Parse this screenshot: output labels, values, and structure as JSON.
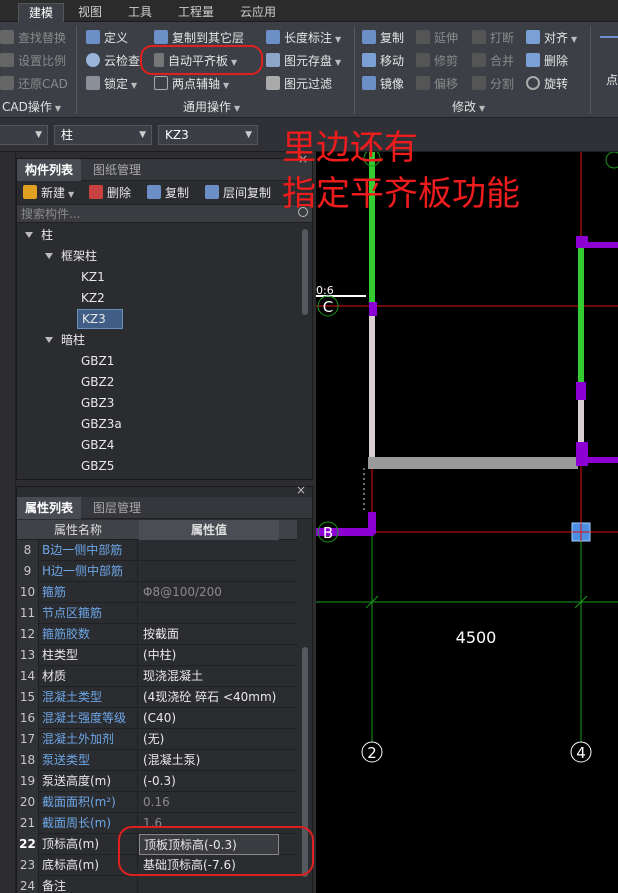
{
  "menu": {
    "tabs": [
      {
        "label": "建模",
        "active": true
      },
      {
        "label": "视图",
        "active": false
      },
      {
        "label": "工具",
        "active": false
      },
      {
        "label": "工程量",
        "active": false
      },
      {
        "label": "云应用",
        "active": false
      }
    ]
  },
  "ribbon": {
    "cad": {
      "find_replace": "查找替换",
      "set_ratio": "设置比例",
      "restore_cad": "还原CAD",
      "group_label": "CAD操作"
    },
    "general": {
      "define": "定义",
      "copy_to_floor": "复制到其它层",
      "length_label": "长度标注",
      "cloud_check": "云检查",
      "auto_align_slab": "自动平齐板",
      "save_element": "图元存盘",
      "lock": "锁定",
      "two_point_axis": "两点辅轴",
      "element_filter": "图元过滤",
      "group_label": "通用操作"
    },
    "modify": {
      "copy": "复制",
      "extend": "延伸",
      "break": "打断",
      "align": "对齐",
      "move": "移动",
      "trim": "修剪",
      "merge": "合并",
      "delete": "删除",
      "mirror": "镜像",
      "offset": "偏移",
      "split": "分割",
      "rotate": "旋转",
      "group_label": "修改"
    },
    "draw_partial": "点"
  },
  "selectors": {
    "category": "柱",
    "component": "KZ3"
  },
  "component_panel": {
    "tab_active": "构件列表",
    "tab_other": "图纸管理",
    "new_btn": "新建",
    "delete_btn": "删除",
    "copy_btn": "复制",
    "floor_copy_btn": "层间复制",
    "search_placeholder": "搜索构件...",
    "tree": {
      "root": "柱",
      "group1": "框架柱",
      "group1_items": [
        "KZ1",
        "KZ2",
        "KZ3"
      ],
      "group2": "暗柱",
      "group2_items": [
        "GBZ1",
        "GBZ2",
        "GBZ3",
        "GBZ3a",
        "GBZ4",
        "GBZ5"
      ]
    }
  },
  "property_panel": {
    "tab_active": "属性列表",
    "tab_other": "图层管理",
    "col_name": "属性名称",
    "col_value": "属性值",
    "rows": [
      {
        "num": "8",
        "name": "B边一侧中部筋",
        "value": "",
        "blue": true,
        "dim": false,
        "bold": false
      },
      {
        "num": "9",
        "name": "H边一侧中部筋",
        "value": "",
        "blue": true,
        "dim": false,
        "bold": false
      },
      {
        "num": "10",
        "name": "箍筋",
        "value": "Φ8@100/200",
        "blue": true,
        "dim": true,
        "bold": false
      },
      {
        "num": "11",
        "name": "节点区箍筋",
        "value": "",
        "blue": true,
        "dim": false,
        "bold": false
      },
      {
        "num": "12",
        "name": "箍筋胶数",
        "value": "按截面",
        "blue": true,
        "dim": false,
        "bold": false
      },
      {
        "num": "13",
        "name": "柱类型",
        "value": "(中柱)",
        "blue": false,
        "dim": false,
        "bold": false
      },
      {
        "num": "14",
        "name": "材质",
        "value": "现浇混凝土",
        "blue": false,
        "dim": false,
        "bold": false
      },
      {
        "num": "15",
        "name": "混凝土类型",
        "value": "(4现浇砼 碎石 <40mm)",
        "blue": true,
        "dim": false,
        "bold": false
      },
      {
        "num": "16",
        "name": "混凝土强度等级",
        "value": "(C40)",
        "blue": true,
        "dim": false,
        "bold": false
      },
      {
        "num": "17",
        "name": "混凝土外加剂",
        "value": "(无)",
        "blue": true,
        "dim": false,
        "bold": false
      },
      {
        "num": "18",
        "name": "泵送类型",
        "value": "(混凝土泵)",
        "blue": true,
        "dim": false,
        "bold": false
      },
      {
        "num": "19",
        "name": "泵送高度(m)",
        "value": "(-0.3)",
        "blue": false,
        "dim": false,
        "bold": false
      },
      {
        "num": "20",
        "name": "截面面积(m²)",
        "value": "0.16",
        "blue": true,
        "dim": true,
        "bold": false
      },
      {
        "num": "21",
        "name": "截面周长(m)",
        "value": "1.6",
        "blue": true,
        "dim": true,
        "bold": false
      },
      {
        "num": "22",
        "name": "顶标高(m)",
        "value": "顶板顶标高(-0.3)",
        "blue": false,
        "dim": false,
        "bold": true
      },
      {
        "num": "23",
        "name": "底标高(m)",
        "value": "基础顶标高(-7.6)",
        "blue": false,
        "dim": false,
        "bold": false
      },
      {
        "num": "24",
        "name": "备注",
        "value": "",
        "blue": false,
        "dim": false,
        "bold": false
      }
    ]
  },
  "canvas": {
    "axis_labels": [
      "B",
      "C",
      "2",
      "4"
    ],
    "dimension": "4500",
    "partial_label": "0:6"
  },
  "annotation": {
    "line1": "里边还有",
    "line2": "指定平齐板功能"
  },
  "colors": {
    "column_green": "#33cc33",
    "column_purple": "#8c00d4",
    "axis_red": "#e01010",
    "axis_green": "#1a9a1a",
    "annotation_red": "#ee1c1c"
  }
}
